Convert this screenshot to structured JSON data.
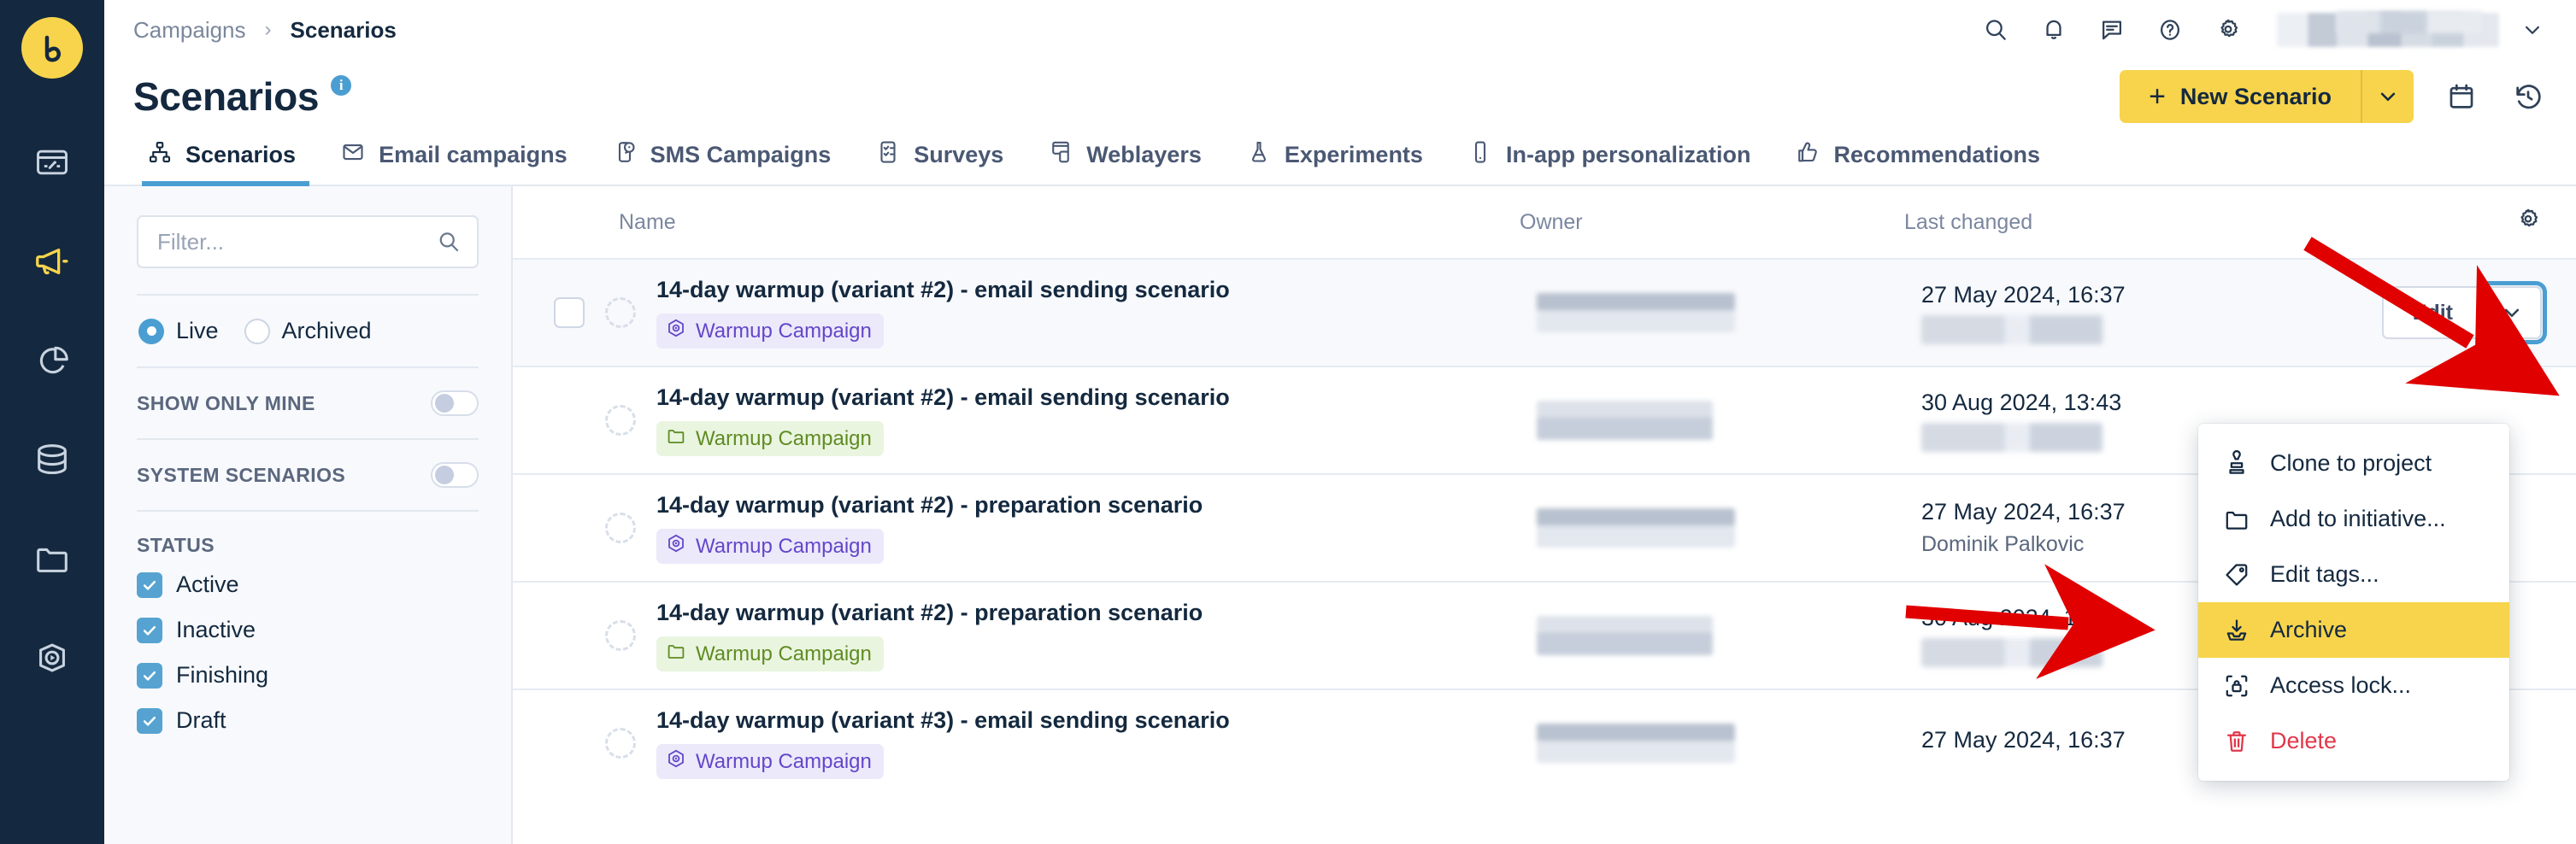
{
  "rail": {
    "logo_alt": "synerise-logo",
    "items": [
      {
        "name": "dashboard",
        "icon": "dashboard-icon"
      },
      {
        "name": "campaigns",
        "icon": "megaphone-icon",
        "active": true
      },
      {
        "name": "analytics",
        "icon": "pie-chart-icon"
      },
      {
        "name": "data",
        "icon": "database-icon"
      },
      {
        "name": "assets",
        "icon": "folder-icon"
      },
      {
        "name": "automation",
        "icon": "play-hex-icon"
      }
    ]
  },
  "topbar": {
    "breadcrumb": {
      "parent": "Campaigns",
      "separator": "›",
      "current": "Scenarios"
    },
    "icons": [
      "search-icon",
      "bell-icon",
      "comment-icon",
      "help-icon",
      "gear-icon"
    ],
    "user_caret": "chevron-down-icon"
  },
  "page": {
    "title": "Scenarios",
    "info_badge": "i",
    "new_button": {
      "plus": "+",
      "label": "New Scenario",
      "caret": "chevron-down-icon"
    },
    "calendar_icon": "calendar-icon",
    "history_icon": "history-icon"
  },
  "tabs": [
    {
      "label": "Scenarios",
      "icon": "sitemap-icon",
      "active": true
    },
    {
      "label": "Email campaigns",
      "icon": "envelope-icon",
      "active": false
    },
    {
      "label": "SMS Campaigns",
      "icon": "sms-icon",
      "active": false
    },
    {
      "label": "Surveys",
      "icon": "survey-icon",
      "active": false
    },
    {
      "label": "Weblayers",
      "icon": "weblayer-icon",
      "active": false
    },
    {
      "label": "Experiments",
      "icon": "flask-icon",
      "active": false
    },
    {
      "label": "In-app personalization",
      "icon": "mobile-icon",
      "active": false
    },
    {
      "label": "Recommendations",
      "icon": "thumbs-up-icon",
      "active": false
    }
  ],
  "filters": {
    "search_placeholder": "Filter...",
    "search_value": "",
    "search_icon": "search-icon",
    "scope": {
      "options": [
        "Live",
        "Archived"
      ],
      "selected": "Live"
    },
    "toggles": [
      {
        "label": "SHOW ONLY MINE",
        "on": false
      },
      {
        "label": "SYSTEM SCENARIOS",
        "on": false
      }
    ],
    "status_title": "STATUS",
    "status_options": [
      {
        "label": "Active",
        "checked": true
      },
      {
        "label": "Inactive",
        "checked": true
      },
      {
        "label": "Finishing",
        "checked": true
      },
      {
        "label": "Draft",
        "checked": true
      }
    ]
  },
  "table": {
    "columns": {
      "name": "Name",
      "owner": "Owner",
      "changed": "Last changed"
    },
    "settings_icon": "gear-icon",
    "rows": [
      {
        "name": "14-day warmup (variant #2) - email sending scenario",
        "tag": {
          "label": "Warmup Campaign",
          "style": "purple",
          "icon": "target-icon"
        },
        "date": "27 May 2024, 16:37",
        "author": "",
        "selected": true,
        "edit_label": "Edit",
        "edit_caret": "chevron-down-icon"
      },
      {
        "name": "14-day warmup (variant #2) - email sending scenario",
        "tag": {
          "label": "Warmup Campaign",
          "style": "green",
          "icon": "folder-icon"
        },
        "date": "30 Aug 2024, 13:43",
        "author": "",
        "selected": false
      },
      {
        "name": "14-day warmup (variant #2) - preparation scenario",
        "tag": {
          "label": "Warmup Campaign",
          "style": "purple",
          "icon": "target-icon"
        },
        "date": "27 May 2024, 16:37",
        "author": "Dominik Palkovic",
        "selected": false
      },
      {
        "name": "14-day warmup (variant #2) - preparation scenario",
        "tag": {
          "label": "Warmup Campaign",
          "style": "green",
          "icon": "folder-icon"
        },
        "date": "30 Aug 2024, 13:43",
        "author": "",
        "selected": false
      },
      {
        "name": "14-day warmup (variant #3) - email sending scenario",
        "tag": {
          "label": "Warmup Campaign",
          "style": "purple",
          "icon": "target-icon"
        },
        "date": "27 May 2024, 16:37",
        "author": "",
        "selected": false
      }
    ]
  },
  "context_menu": {
    "items": [
      {
        "label": "Clone to project",
        "icon": "stamp-icon",
        "highlighted": false,
        "danger": false
      },
      {
        "label": "Add to initiative...",
        "icon": "folder-icon",
        "highlighted": false,
        "danger": false
      },
      {
        "label": "Edit tags...",
        "icon": "tag-icon",
        "highlighted": false,
        "danger": false
      },
      {
        "label": "Archive",
        "icon": "archive-icon",
        "highlighted": true,
        "danger": false
      },
      {
        "label": "Access lock...",
        "icon": "access-lock-icon",
        "highlighted": false,
        "danger": false
      },
      {
        "label": "Delete",
        "icon": "trash-icon",
        "highlighted": false,
        "danger": true
      }
    ]
  },
  "colors": {
    "brand_yellow": "#f7d44c",
    "navy": "#14293f",
    "accent_blue": "#4b9ed1",
    "danger_red": "#e0384a",
    "tag_purple": "#6347c8",
    "tag_green": "#5f8c22",
    "annotation_red": "#e00000"
  }
}
